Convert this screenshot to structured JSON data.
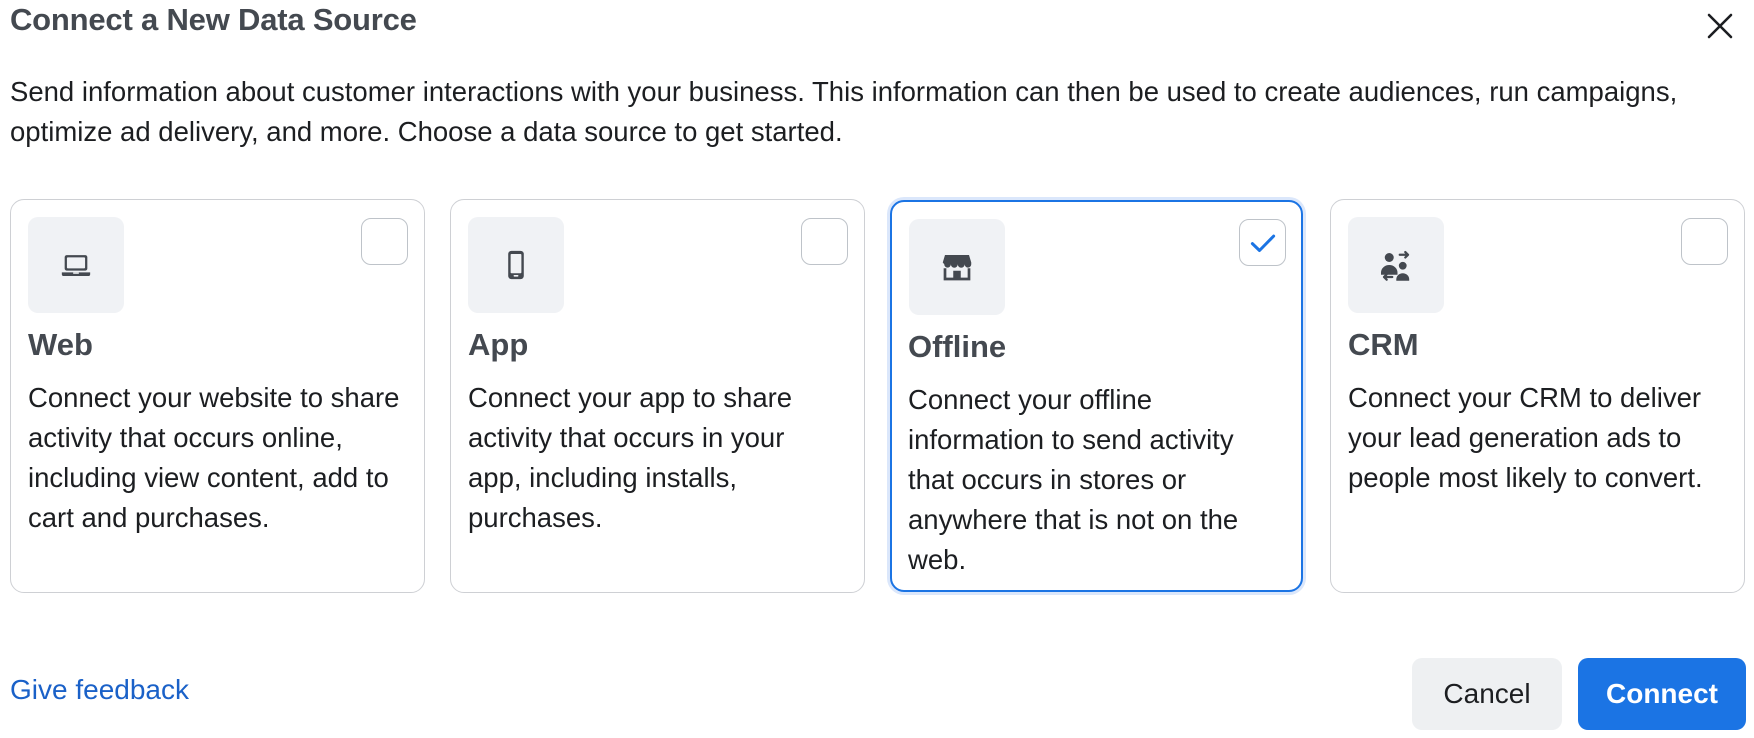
{
  "dialog": {
    "title": "Connect a New Data Source",
    "description": "Send information about customer interactions with your business. This information can then be used to create audiences, run campaigns, optimize ad delivery, and more. Choose a data source to get started."
  },
  "sources": [
    {
      "title": "Web",
      "icon": "laptop-icon",
      "checked": false,
      "description": "Connect your website to share activity that occurs online, including view content, add to cart and purchases."
    },
    {
      "title": "App",
      "icon": "mobile-phone-icon",
      "checked": false,
      "description": "Connect your app to share activity that occurs in your app, including installs, purchases."
    },
    {
      "title": "Offline",
      "icon": "store-icon",
      "checked": true,
      "description": "Connect your offline information to send activity that occurs in stores or anywhere that is not on the web."
    },
    {
      "title": "CRM",
      "icon": "people-sync-icon",
      "checked": false,
      "description": "Connect your CRM to deliver your lead generation ads to people most likely to convert."
    }
  ],
  "footer": {
    "feedback_label": "Give feedback",
    "cancel_label": "Cancel",
    "connect_label": "Connect"
  },
  "colors": {
    "accent": "#1b74e4",
    "link": "#1a61c8",
    "selected_ring": "#dbe7fb"
  }
}
